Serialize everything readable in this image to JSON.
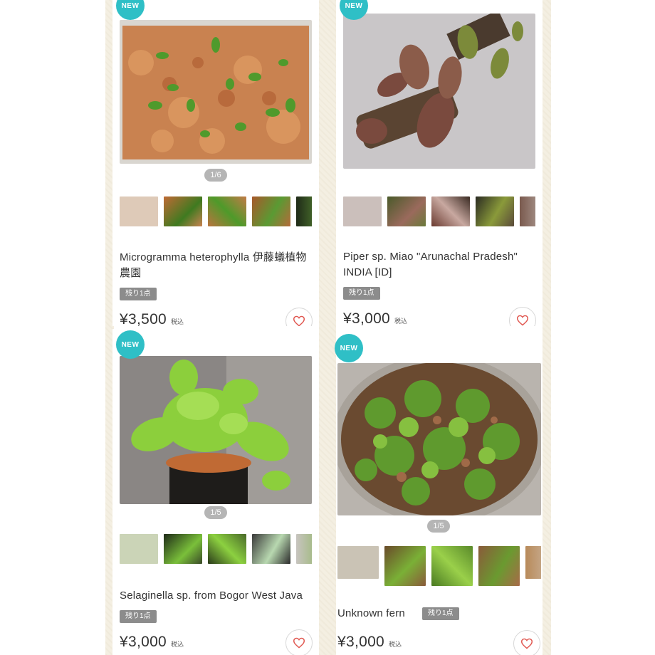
{
  "badge": "NEW",
  "tax_label": "税込",
  "products": [
    {
      "title": "Microgramma heterophylla 伊藤蟻植物農園",
      "pager": "1/6",
      "stock": "残り1点",
      "price": "¥3,500"
    },
    {
      "title": "Piper sp. Miao \"Arunachal Pradesh\" INDIA [ID]",
      "pager": "",
      "stock": "残り1点",
      "price": "¥3,000"
    },
    {
      "title": "Selaginella sp. from Bogor West Java",
      "pager": "1/5",
      "stock": "残り1点",
      "price": "¥3,000"
    },
    {
      "title": "Unknown fern",
      "pager": "1/5",
      "stock": "残り1点",
      "price": "¥3,000"
    }
  ],
  "colors": {
    "badge": "#2fbfc6",
    "stock_tag": "#8c8c8c",
    "heart": "#e0564f"
  },
  "icons": {
    "favorite": "heart-icon"
  }
}
